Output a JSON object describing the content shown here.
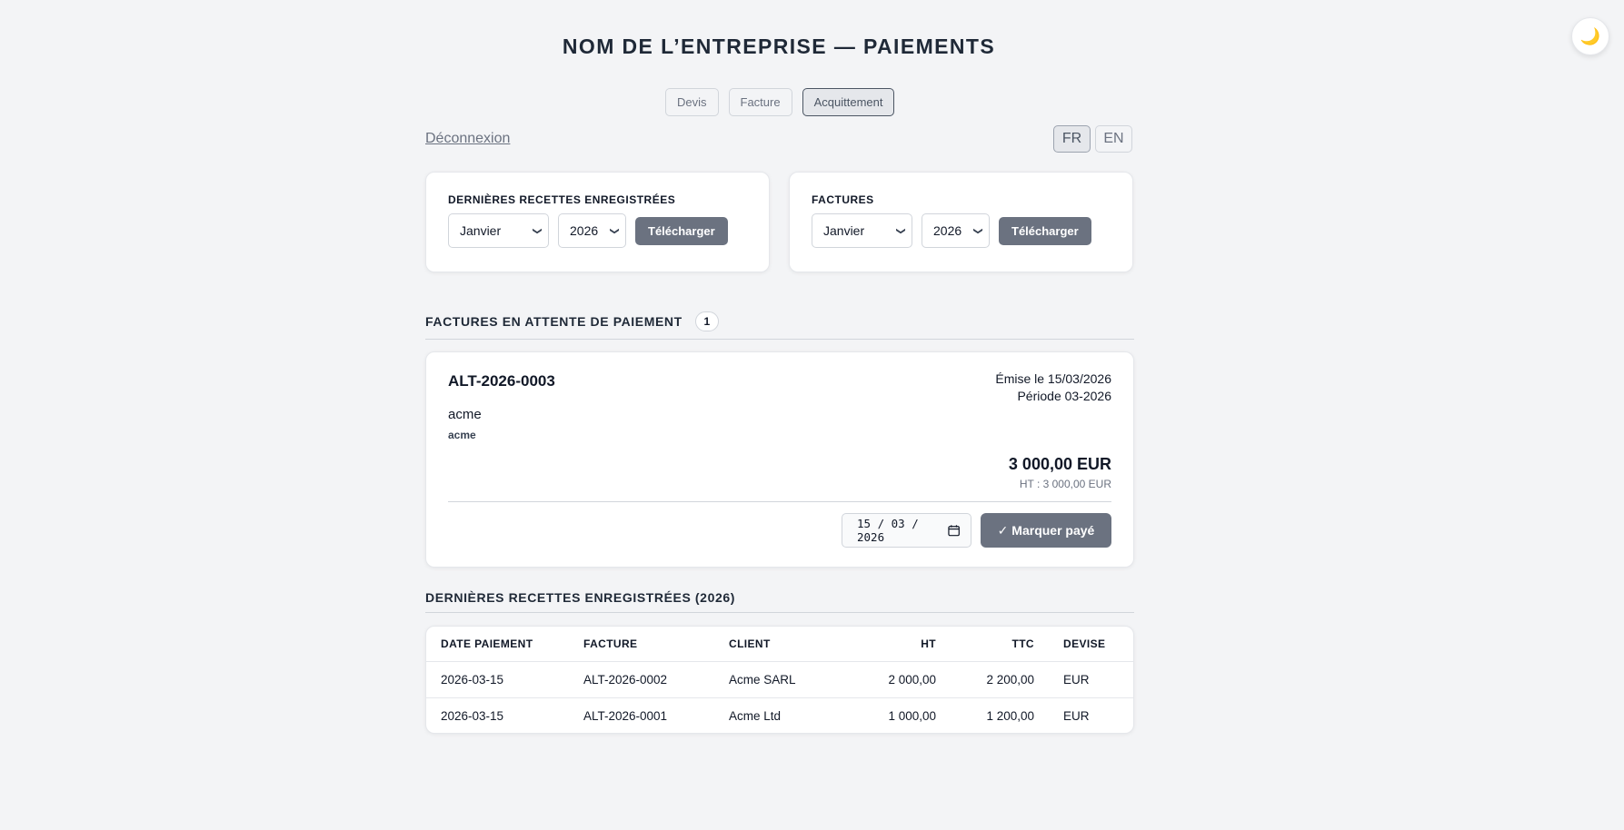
{
  "theme_toggle": {
    "icon": "moon-icon",
    "glyph": "🌙"
  },
  "header": {
    "title": "NOM DE L’ENTREPRISE — PAIEMENTS"
  },
  "nav": {
    "devis": "Devis",
    "facture": "Facture",
    "acquittement": "Acquittement",
    "active": "Acquittement"
  },
  "logout_label": "Déconnexion",
  "lang": {
    "fr": "FR",
    "en": "EN",
    "active": "FR"
  },
  "exports": [
    {
      "title": "DERNIÈRES RECETTES ENREGISTRÉES",
      "month": "Janvier",
      "year": "2026",
      "button": "Télécharger"
    },
    {
      "title": "FACTURES",
      "month": "Janvier",
      "year": "2026",
      "button": "Télécharger"
    }
  ],
  "pending": {
    "title": "FACTURES EN ATTENTE DE PAIEMENT",
    "count": "1",
    "invoice": {
      "number": "ALT-2026-0003",
      "emitted": "Émise le 15/03/2026",
      "period": "Période 03-2026",
      "client": "acme",
      "client_sub": "acme",
      "amount": "3 000,00 EUR",
      "ht": "HT : 3 000,00 EUR",
      "date_value": "15 / 03 / 2026",
      "pay_button": "✓ Marquer payé"
    }
  },
  "receipts": {
    "title": "DERNIÈRES RECETTES ENREGISTRÉES (2026)",
    "columns": [
      "DATE PAIEMENT",
      "FACTURE",
      "CLIENT",
      "HT",
      "TTC",
      "DEVISE"
    ],
    "rows": [
      [
        "2026-03-15",
        "ALT-2026-0002",
        "Acme SARL",
        "2 000,00",
        "2 200,00",
        "EUR"
      ],
      [
        "2026-03-15",
        "ALT-2026-0001",
        "Acme Ltd",
        "1 000,00",
        "1 200,00",
        "EUR"
      ]
    ]
  },
  "colors": {
    "background": "#f3f4f6",
    "button": "#6b7280",
    "card": "#ffffff"
  }
}
